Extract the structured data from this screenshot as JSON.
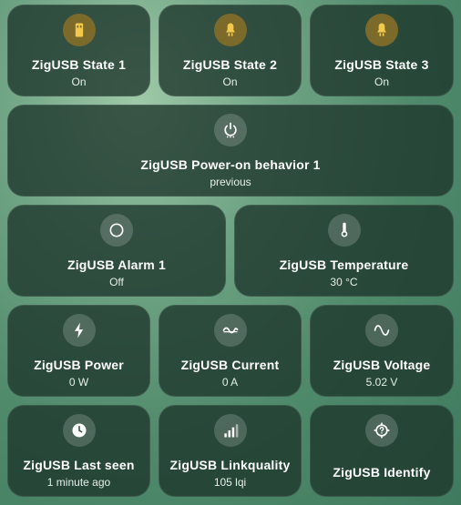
{
  "tiles": [
    {
      "name": "ZigUSB State 1",
      "state": "On",
      "icon": "usb-flash-icon",
      "on": true
    },
    {
      "name": "ZigUSB State 2",
      "state": "On",
      "icon": "lightbulb-icon",
      "on": true
    },
    {
      "name": "ZigUSB State 3",
      "state": "On",
      "icon": "lightbulb-icon",
      "on": true
    },
    {
      "name": "ZigUSB Power-on behavior 1",
      "state": "previous",
      "icon": "power-settings-icon",
      "on": false
    },
    {
      "name": "ZigUSB Alarm 1",
      "state": "Off",
      "icon": "circle-outline-icon",
      "on": false
    },
    {
      "name": "ZigUSB Temperature",
      "state": "30 °C",
      "icon": "thermometer-icon",
      "on": false
    },
    {
      "name": "ZigUSB Power",
      "state": "0 W",
      "icon": "lightning-bolt-icon",
      "on": false
    },
    {
      "name": "ZigUSB Current",
      "state": "0 A",
      "icon": "current-ac-icon",
      "on": false
    },
    {
      "name": "ZigUSB Voltage",
      "state": "5.02 V",
      "icon": "sine-wave-icon",
      "on": false
    },
    {
      "name": "ZigUSB Last seen",
      "state": "1 minute ago",
      "icon": "clock-icon",
      "on": false
    },
    {
      "name": "ZigUSB Linkquality",
      "state": "105 lqi",
      "icon": "signal-bars-icon",
      "on": false
    },
    {
      "name": "ZigUSB Identify",
      "state": "",
      "icon": "identify-icon",
      "on": false
    }
  ],
  "colors": {
    "on_icon": "#f2c94c",
    "off_icon": "#ffffff",
    "on_bg": "#7c6a2a"
  }
}
